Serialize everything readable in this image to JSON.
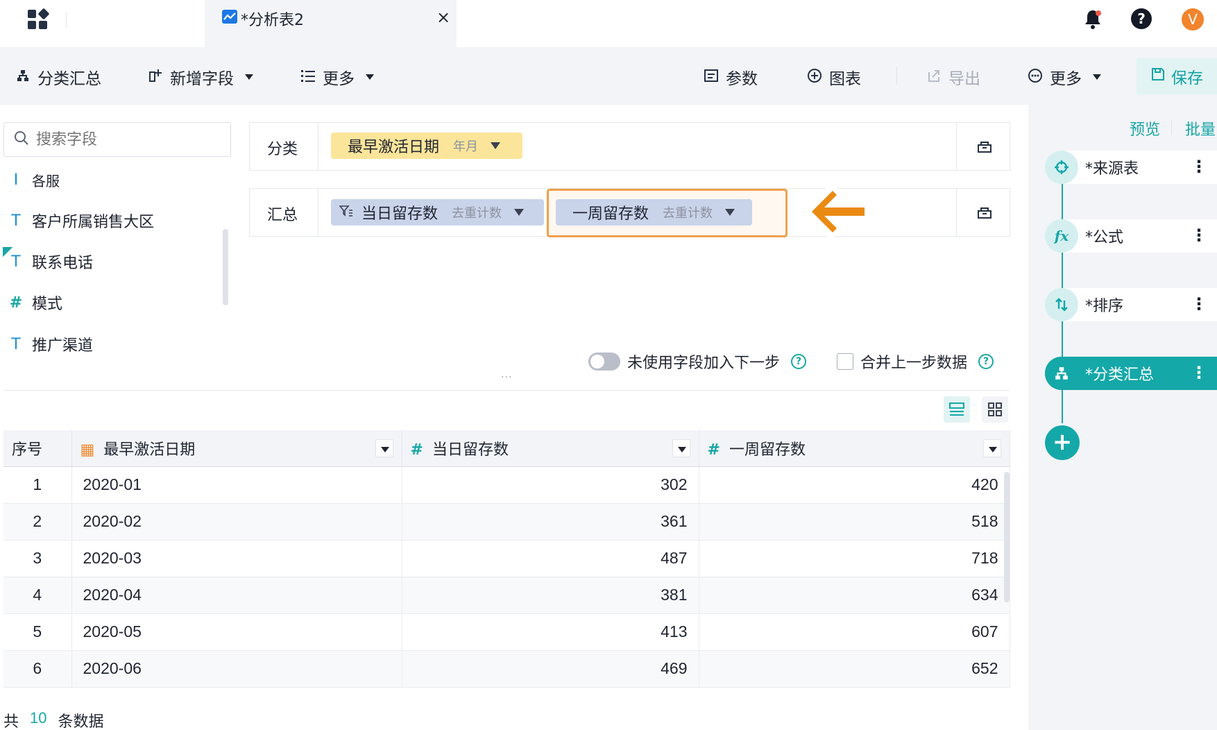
{
  "tab": {
    "title": "*分析表2",
    "close": "×"
  },
  "header": {
    "help": "?",
    "avatar": "V"
  },
  "toolbar": {
    "group_summary": "分类汇总",
    "add_field": "新增字段",
    "more_left": "更多",
    "params": "参数",
    "chart": "图表",
    "export": "导出",
    "more_right": "更多",
    "save": "保存"
  },
  "field_panel": {
    "search_placeholder": "搜索字段",
    "fields": [
      {
        "icon": "I",
        "label": "各服"
      },
      {
        "icon": "T",
        "label": "客户所属销售大区"
      },
      {
        "icon": "T",
        "label": "联系电话"
      },
      {
        "icon": "#",
        "label": "模式"
      },
      {
        "icon": "T",
        "label": "推广渠道"
      }
    ]
  },
  "config": {
    "category_label": "分类",
    "category_chip": {
      "label": "最早激活日期",
      "sub": "年月"
    },
    "summary_label": "汇总",
    "summary_chips": [
      {
        "label": "当日留存数",
        "sub": "去重计数"
      },
      {
        "label": "一周留存数",
        "sub": "去重计数"
      }
    ],
    "options": {
      "unused_fields": "未使用字段加入下一步",
      "merge_prev": "合并上一步数据"
    },
    "colors": {
      "accent": "#15a8a8",
      "highlight": "#f0a04b",
      "category_chip": "#fbe59a",
      "summary_chip": "#c9d3ea"
    }
  },
  "table": {
    "headers": [
      "序号",
      "最早激活日期",
      "当日留存数",
      "一周留存数"
    ],
    "rows": [
      [
        "1",
        "2020-01",
        "302",
        "420"
      ],
      [
        "2",
        "2020-02",
        "361",
        "518"
      ],
      [
        "3",
        "2020-03",
        "487",
        "718"
      ],
      [
        "4",
        "2020-04",
        "381",
        "634"
      ],
      [
        "5",
        "2020-05",
        "413",
        "607"
      ],
      [
        "6",
        "2020-06",
        "469",
        "652"
      ]
    ],
    "footer": {
      "prefix": "共",
      "count": "10",
      "suffix": "条数据"
    }
  },
  "right_panel": {
    "preview": "预览",
    "batch": "批量",
    "steps": [
      {
        "label": "*来源表",
        "icon": "crosshair-icon"
      },
      {
        "label": "*公式",
        "icon": "fx-icon"
      },
      {
        "label": "*排序",
        "icon": "sort-icon"
      },
      {
        "label": "*分类汇总",
        "icon": "group-summary-icon",
        "active": true
      }
    ]
  }
}
